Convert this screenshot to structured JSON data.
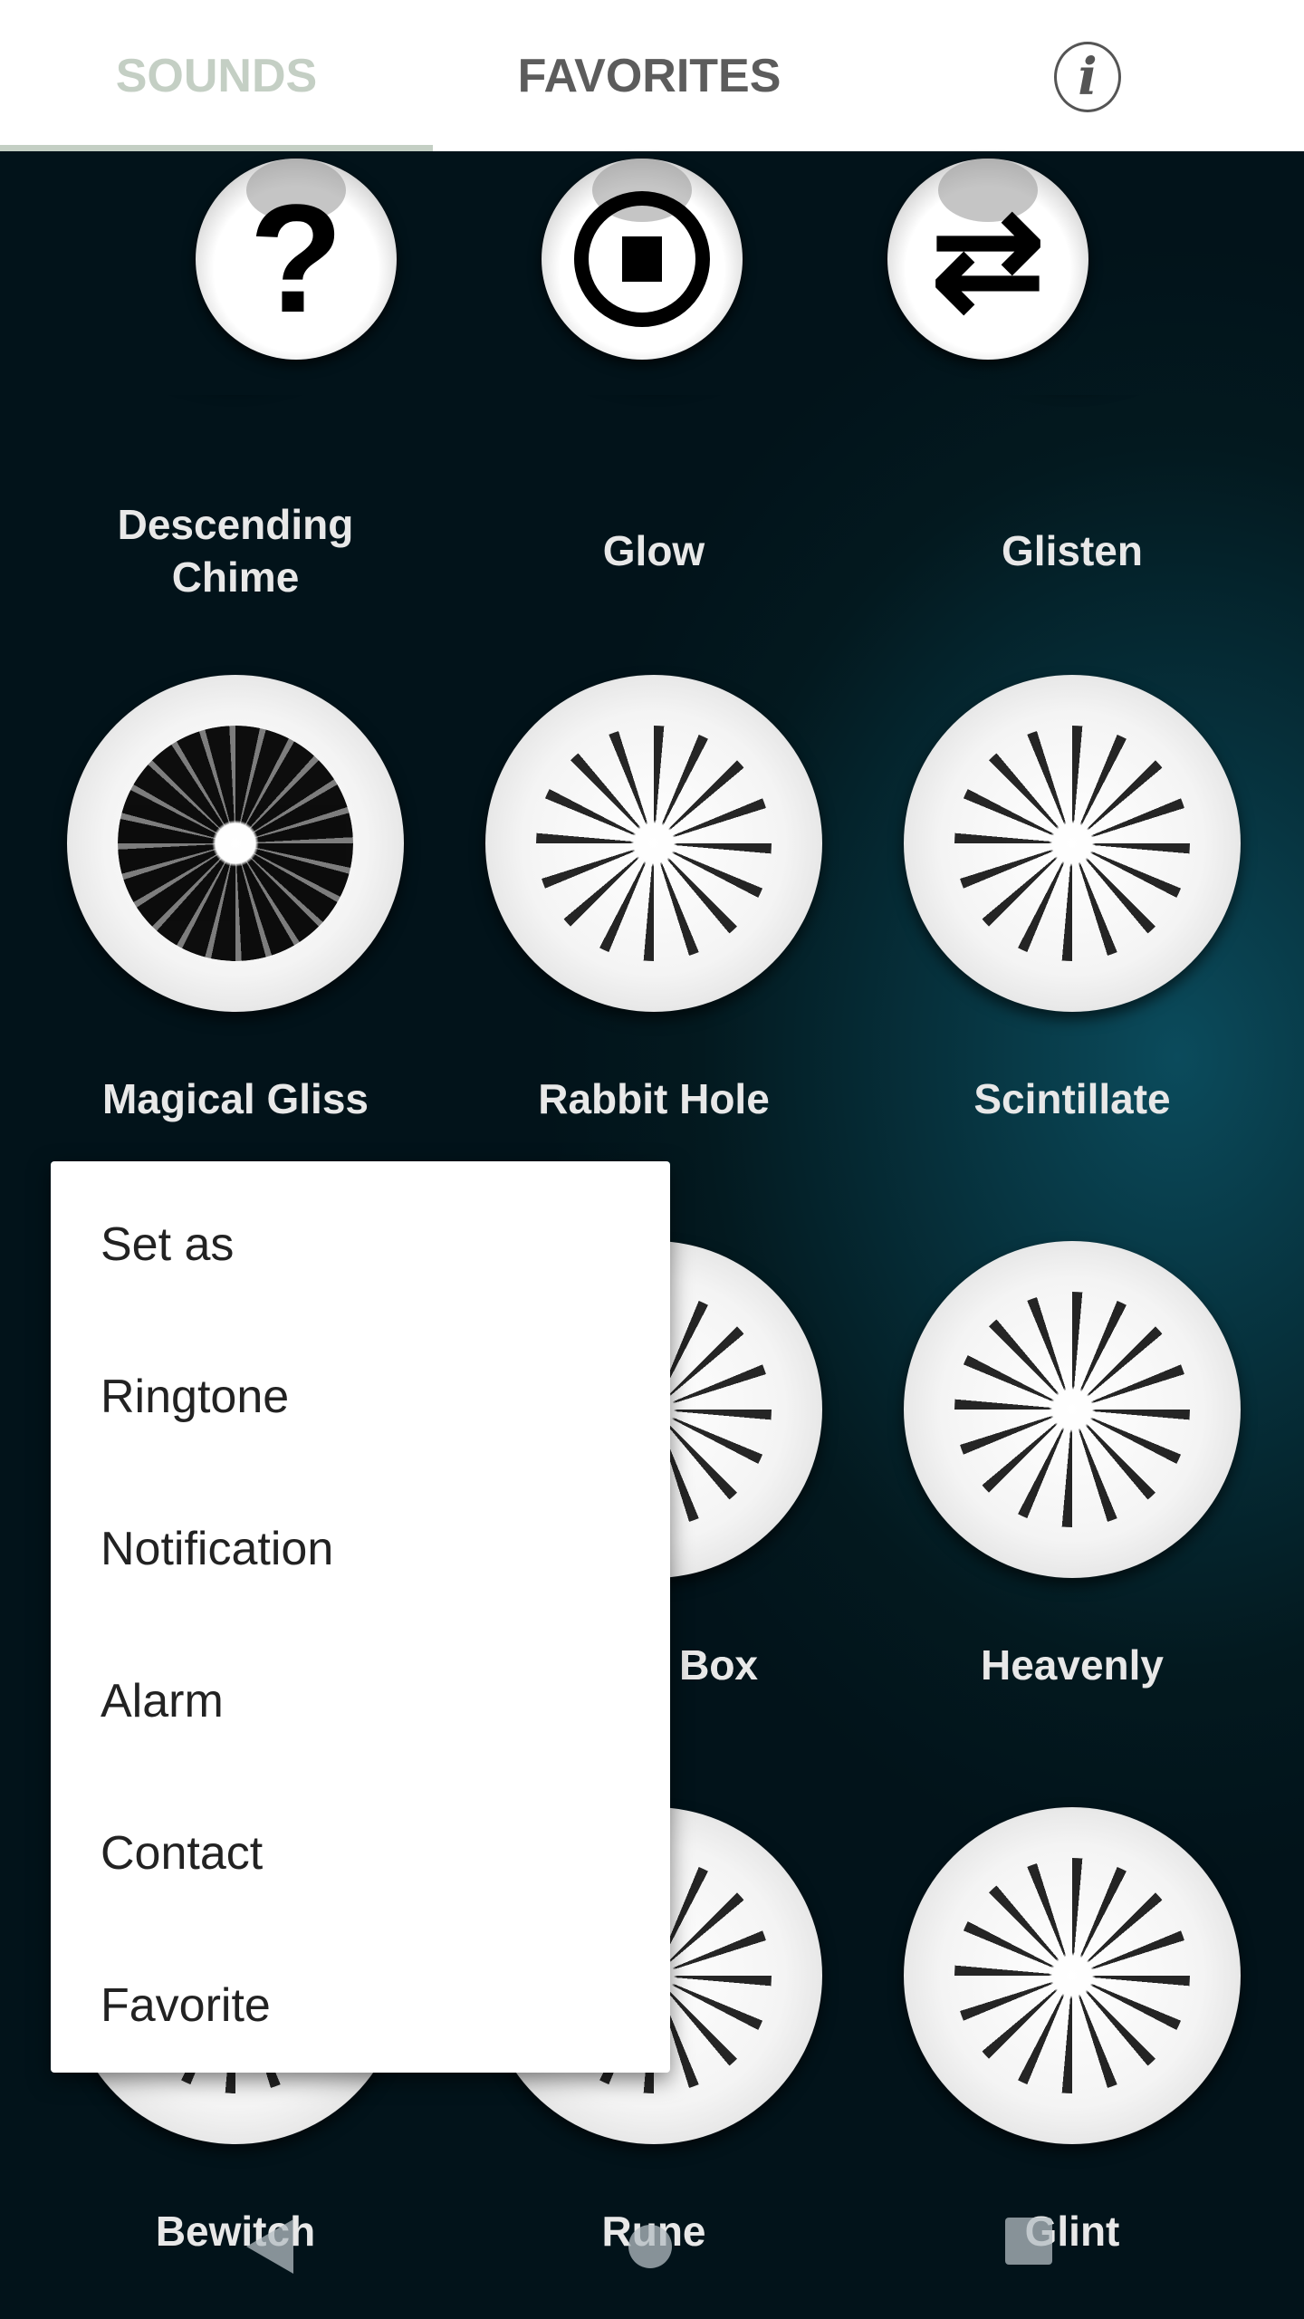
{
  "tabs": [
    {
      "label": "SOUNDS",
      "active": true
    },
    {
      "label": "FAVORITES",
      "active": false
    }
  ],
  "info_icon": "info-icon",
  "accent": "#c4cfc4",
  "controls": [
    {
      "icon": "help-icon",
      "glyph": "?"
    },
    {
      "icon": "stop-icon"
    },
    {
      "icon": "repeat-icon",
      "glyph": "⇄"
    }
  ],
  "sounds": [
    "Descending\nChime",
    "Glow",
    "Glisten",
    "Magical Gliss",
    "Rabbit Hole",
    "Scintillate",
    "Music Box",
    "Box",
    "Heavenly",
    "Bewitch",
    "Rune",
    "Glint"
  ],
  "sound_labels": {
    "r1": [
      "Descending",
      "Chime",
      "Glow",
      "Glisten"
    ],
    "r2": [
      "Magical Gliss",
      "Rabbit Hole",
      "Scintillate"
    ],
    "r3": [
      "Box",
      "Heavenly"
    ],
    "r4": [
      "Bewitch",
      "Rune",
      "Glint"
    ]
  },
  "menu": {
    "items": [
      "Set as",
      "Ringtone",
      "Notification",
      "Alarm",
      "Contact",
      "Favorite"
    ]
  }
}
